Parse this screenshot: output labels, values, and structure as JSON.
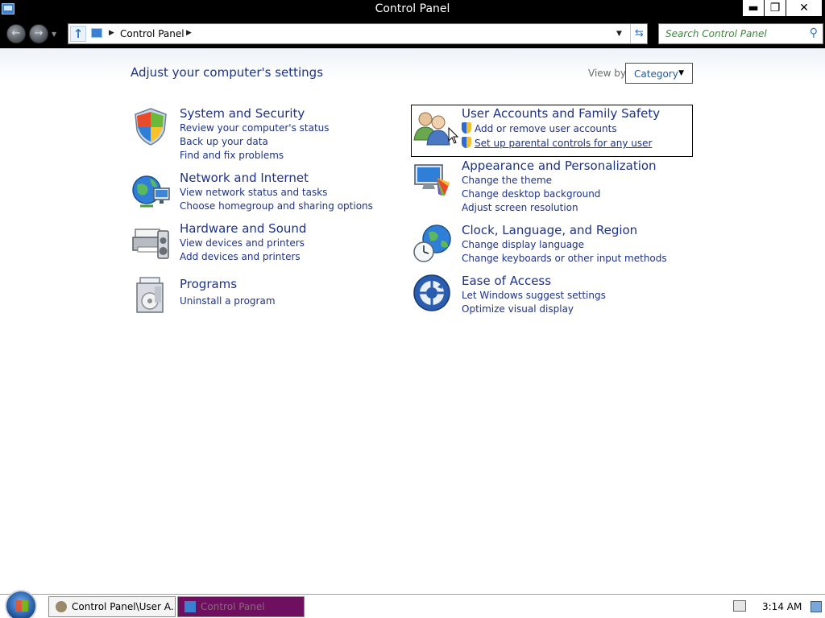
{
  "window": {
    "title": "Control Panel",
    "min_label": "▬",
    "max_label": "❐",
    "close_label": "✕"
  },
  "address": {
    "crumb": "Control Panel",
    "search_placeholder": "Search Control Panel"
  },
  "main": {
    "heading": "Adjust your computer's settings",
    "view_by_label": "View by:",
    "view_by_value": "Category"
  },
  "categories": [
    {
      "title": "System and Security",
      "links": [
        "Review your computer's status",
        "Back up your data",
        "Find and fix problems"
      ]
    },
    {
      "title": "Network and Internet",
      "links": [
        "View network status and tasks",
        "Choose homegroup and sharing options"
      ]
    },
    {
      "title": "Hardware and Sound",
      "links": [
        "View devices and printers",
        "Add devices and printers"
      ]
    },
    {
      "title": "Programs",
      "links": [
        "Uninstall a program"
      ]
    },
    {
      "title": "User Accounts and Family Safety",
      "links": [
        "Add or remove user accounts",
        "Set up parental controls for any user"
      ]
    },
    {
      "title": "Appearance and Personalization",
      "links": [
        "Change the theme",
        "Change desktop background",
        "Adjust screen resolution"
      ]
    },
    {
      "title": "Clock, Language, and Region",
      "links": [
        "Change display language",
        "Change keyboards or other input methods"
      ]
    },
    {
      "title": "Ease of Access",
      "links": [
        "Let Windows suggest settings",
        "Optimize visual display"
      ]
    }
  ],
  "taskbar": {
    "items": [
      "Control Panel\\User A...",
      "Control Panel"
    ],
    "clock": "3:14 AM"
  },
  "colors": {
    "link": "#1e3287",
    "title_bar": "#000000",
    "active_task": "#6e0f5f"
  }
}
